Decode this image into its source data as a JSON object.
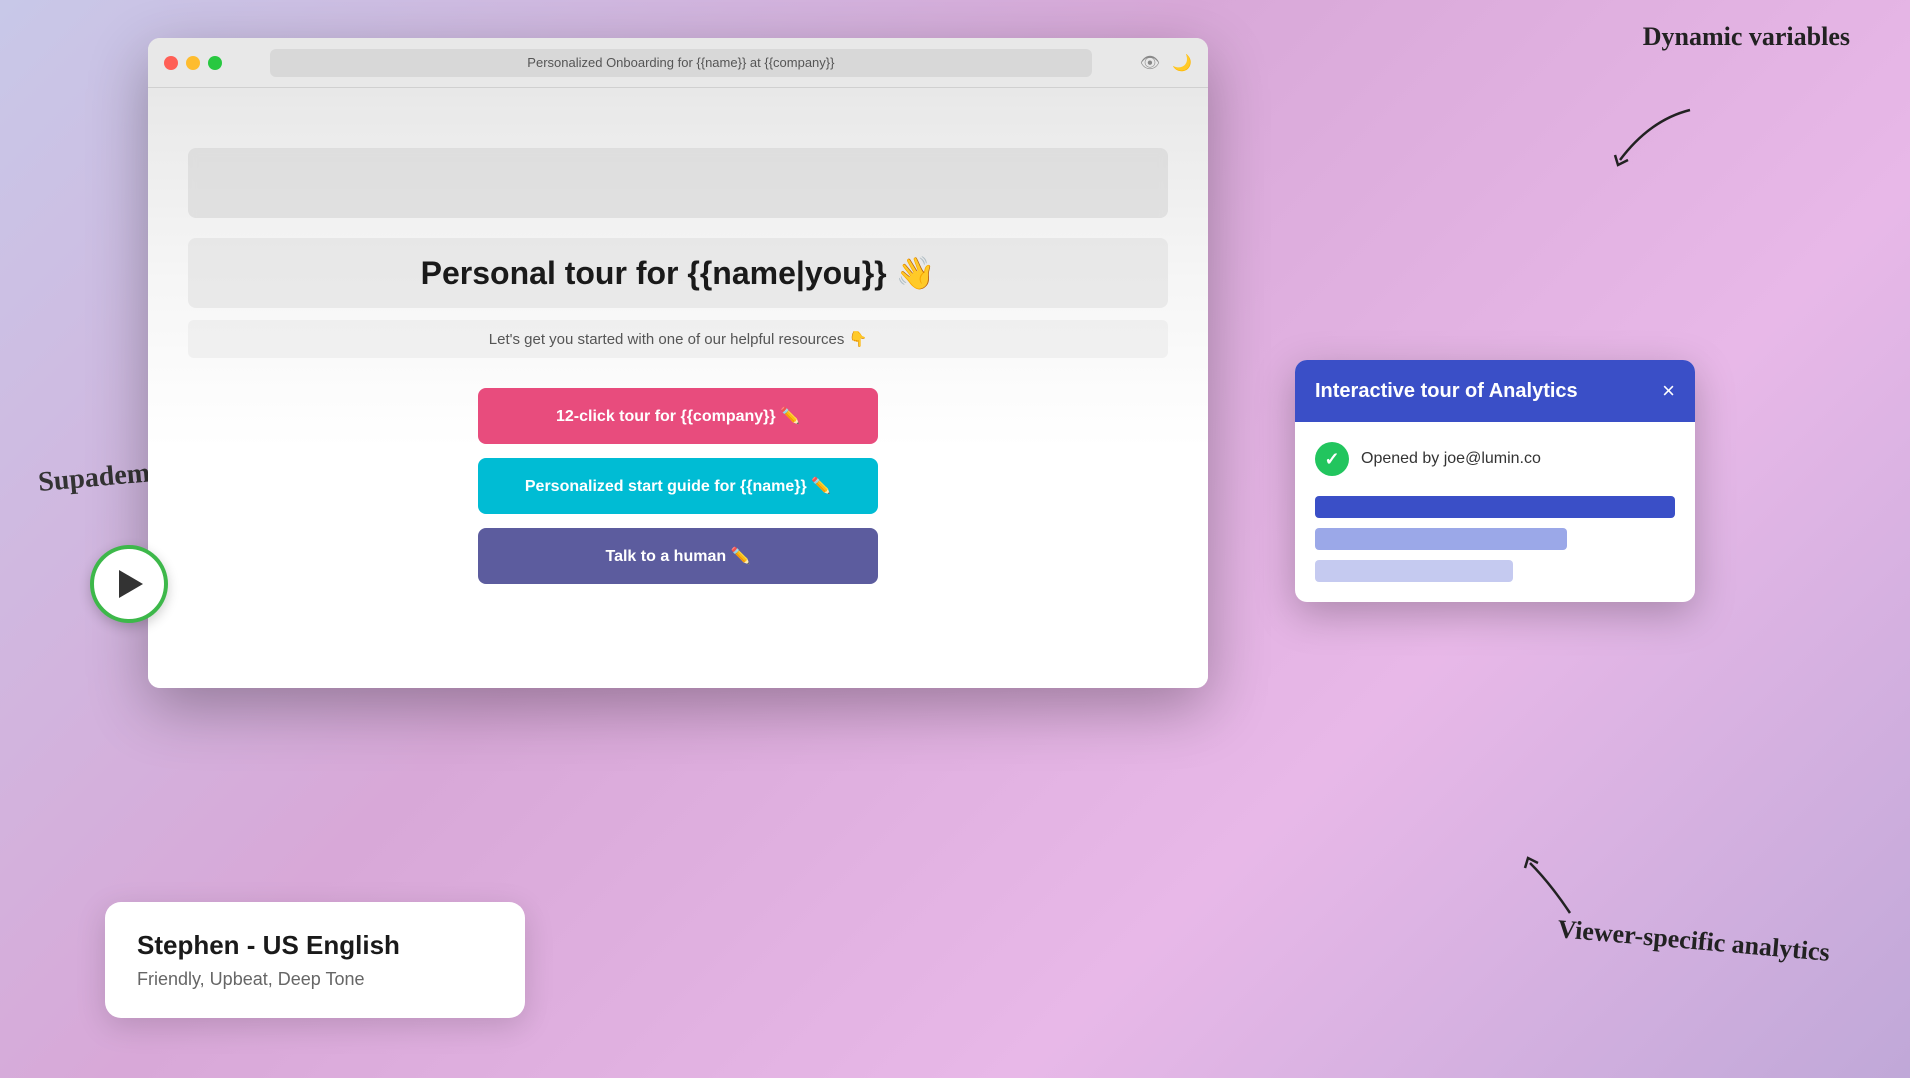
{
  "annotations": {
    "dynamic_vars": "Dynamic variables",
    "supademo_ai": "Supademo AI",
    "viewer_analytics": "Viewer-specific analytics"
  },
  "browser": {
    "url_bar": "Personalized Onboarding for {{name}} at {{company}}",
    "main_heading": "Personal tour for {{name|you}} 👋",
    "sub_heading": "Let's get you started with one of our helpful resources 👇",
    "buttons": [
      {
        "label": "12-click tour for {{company}} ✏️",
        "variant": "red"
      },
      {
        "label": "Personalized start guide for {{name}} ✏️",
        "variant": "cyan"
      },
      {
        "label": "Talk to a human ✏️",
        "variant": "purple"
      }
    ]
  },
  "analytics_popup": {
    "title": "Interactive tour of Analytics",
    "close_label": "×",
    "opened_by": "Opened by joe@lumin.co"
  },
  "voice_card": {
    "name": "Stephen - US English",
    "description": "Friendly, Upbeat, Deep Tone"
  },
  "play_button": {
    "label": "play"
  }
}
